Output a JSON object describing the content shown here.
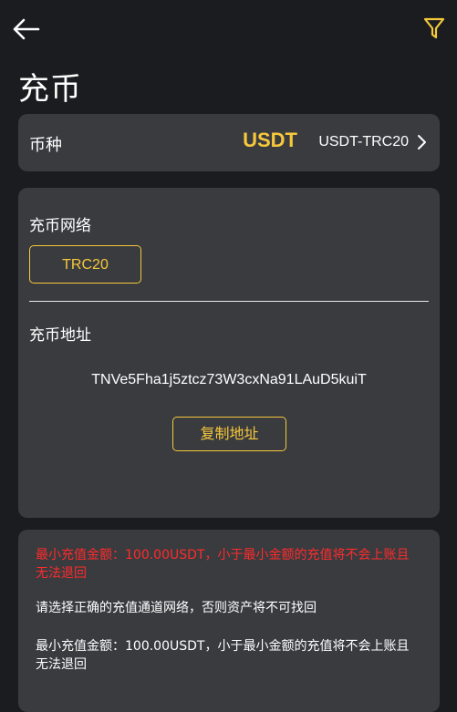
{
  "header": {
    "title": "充币",
    "back_icon": "arrow-left-icon",
    "filter_icon": "filter-icon",
    "filter_color": "#f6c83b"
  },
  "coin": {
    "label": "币种",
    "symbol": "USDT",
    "network": "USDT-TRC20",
    "chevron_icon": "chevron-right-icon"
  },
  "network": {
    "label": "充币网络",
    "selected": "TRC20"
  },
  "address": {
    "label": "充币地址",
    "value": "TNVe5Fha1j5ztcz73W3cxNa91LAuD5kuiT",
    "copy_label": "复制地址"
  },
  "notices": [
    "最小充值金额：100.00USDT，小于最小金额的充值将不会上账且无法退回",
    "请选择正确的充值通道网络，否则资产将不可找回",
    "最小充值金额：100.00USDT，小于最小金额的充值将不会上账且无法退回"
  ],
  "colors": {
    "accent": "#f6c83b",
    "warning": "#ff2b2b",
    "background": "#1b1c20",
    "card": "#3a3b3f"
  }
}
